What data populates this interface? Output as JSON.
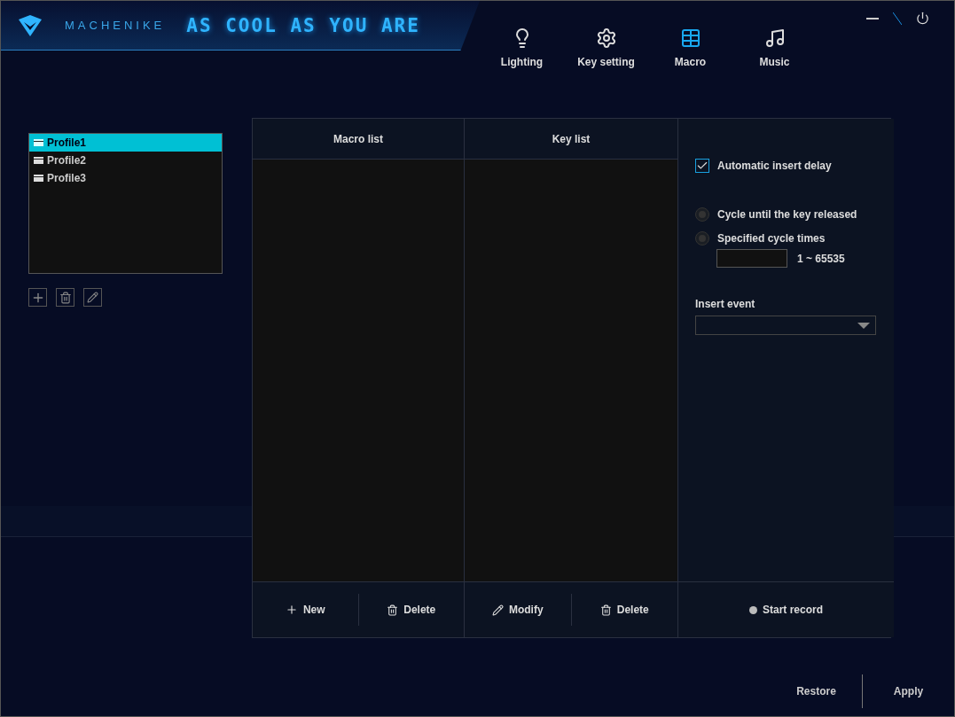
{
  "brand": {
    "name": "MACHENIKE",
    "slogan": "AS COOL AS YOU ARE"
  },
  "tabs": [
    {
      "label": "Lighting",
      "kind": "bulb",
      "selected": false
    },
    {
      "label": "Key setting",
      "kind": "gear",
      "selected": false
    },
    {
      "label": "Macro",
      "kind": "grid",
      "selected": true
    },
    {
      "label": "Music",
      "kind": "note",
      "selected": false
    }
  ],
  "profiles": [
    {
      "label": "Profile1",
      "selected": true
    },
    {
      "label": "Profile2",
      "selected": false
    },
    {
      "label": "Profile3",
      "selected": false
    }
  ],
  "macro": {
    "columns": [
      "Macro list",
      "Key list"
    ],
    "buttons": [
      {
        "label": "New",
        "kind": "new"
      },
      {
        "label": "Delete",
        "kind": "delete"
      },
      {
        "label": "Modify",
        "kind": "modify"
      },
      {
        "label": "Delete",
        "kind": "delete"
      }
    ],
    "auto_delay": {
      "label": "Automatic insert delay",
      "checked": true
    },
    "cycle_options": [
      {
        "label": "Cycle until the key released",
        "selected": false
      },
      {
        "label": "Specified cycle times",
        "selected": false
      }
    ],
    "cycle_range": "1 ~ 65535",
    "insert_event": "Insert event",
    "record": "Start record"
  },
  "footer": [
    "Restore",
    "Apply"
  ]
}
